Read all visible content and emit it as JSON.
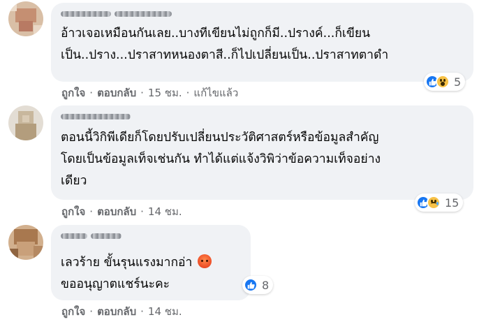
{
  "comments": [
    {
      "text_lines": [
        "อ้าวเจอเหมือนกันเลย..บางทีเขียนไม่ถูกก็มี..ปรางค์...ก็เขียน",
        "เป็น..ปราง...ปราสาทหนองตาสี..ก็ไปเปลี่ยนเป็น..ปราสาทตาดำ"
      ],
      "reactions": [
        "like",
        "wow"
      ],
      "reaction_count": "5",
      "actions": {
        "like": "ถูกใจ",
        "reply": "ตอบกลับ",
        "time": "15 ชม.",
        "edited": "แก้ไขแล้ว"
      }
    },
    {
      "text_lines": [
        "ตอนนี้วิกิพีเดียก็โดยปรับเปลี่ยนประวัติศาสตร์หรือข้อมูลสำคัญ",
        "โดยเป็นข้อมูลเท็จเช่นกัน ทำได้แต่แจ้งวิพิว่าข้อความเท็จอย่าง",
        "เดียว"
      ],
      "reactions": [
        "like",
        "sad"
      ],
      "reaction_count": "15",
      "actions": {
        "like": "ถูกใจ",
        "reply": "ตอบกลับ",
        "time": "14 ชม."
      }
    },
    {
      "text_lines": [
        "เลวร้าย ขั้นรุนแรงมากอ่า",
        "ขออนุญาตแชร์นะคะ"
      ],
      "reactions": [
        "like"
      ],
      "reaction_count": "8",
      "actions": {
        "like": "ถูกใจ",
        "reply": "ตอบกลับ",
        "time": "14 ชม."
      }
    }
  ],
  "colors": {
    "bubble": "#f0f2f5",
    "text": "#050505",
    "meta": "#65676b",
    "like_blue": "#1877f2",
    "emoji_yellow": "#f7c146",
    "angry_red": "#f0542b"
  },
  "icons": {
    "like": "thumbs-up-icon",
    "wow": "wow-face-icon",
    "sad": "crying-face-icon",
    "angry": "angry-face-emoji"
  }
}
